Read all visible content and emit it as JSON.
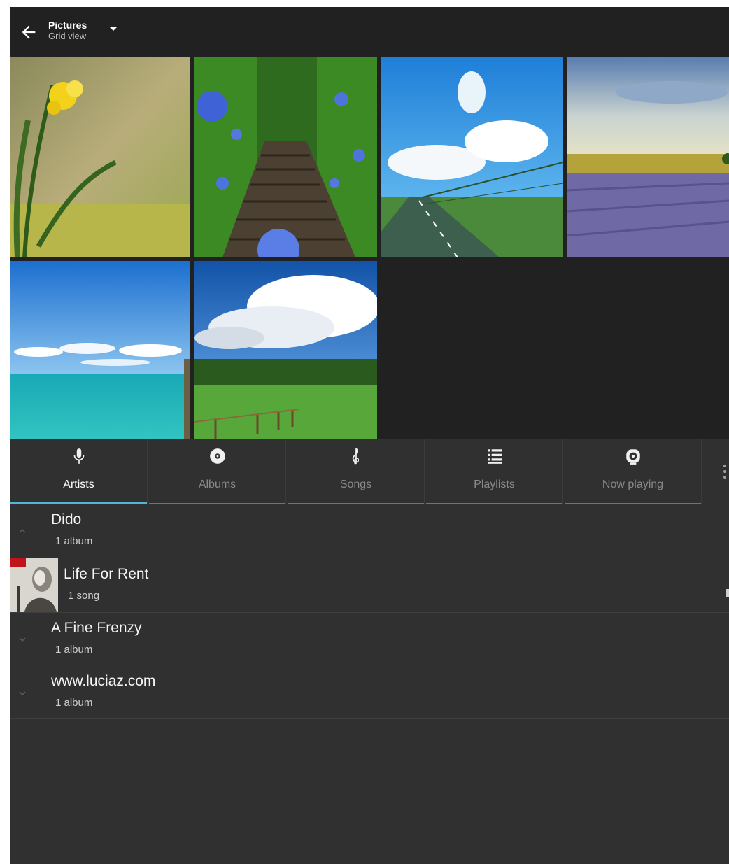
{
  "header": {
    "title": "Pictures",
    "subtitle": "Grid view",
    "back_icon": "arrow-left-icon",
    "dropdown_icon": "caret-down-icon"
  },
  "gallery": {
    "images": [
      {
        "subject": "yellow daffodil"
      },
      {
        "subject": "stairway between blue flowers"
      },
      {
        "subject": "road under blue sky"
      },
      {
        "subject": "lavender field"
      },
      {
        "subject": "turquoise sea"
      },
      {
        "subject": "green meadow with clouds"
      }
    ]
  },
  "tabs": [
    {
      "label": "Artists",
      "icon": "microphone-icon",
      "active": true
    },
    {
      "label": "Albums",
      "icon": "disc-icon",
      "active": false
    },
    {
      "label": "Songs",
      "icon": "treble-clef-icon",
      "active": false
    },
    {
      "label": "Playlists",
      "icon": "list-icon",
      "active": false
    },
    {
      "label": "Now playing",
      "icon": "speaker-icon",
      "active": false
    }
  ],
  "list": {
    "items": [
      {
        "title": "Dido",
        "subtitle": "1 album",
        "expanded": true
      },
      {
        "title": "Life For Rent",
        "subtitle": "1 song",
        "type": "album"
      },
      {
        "title": "A Fine Frenzy",
        "subtitle": "1 album",
        "expanded": false
      },
      {
        "title": "www.luciaz.com",
        "subtitle": "1 album",
        "expanded": false
      }
    ]
  },
  "colors": {
    "accent": "#4fb6da",
    "background": "#303030",
    "header": "#212121"
  }
}
